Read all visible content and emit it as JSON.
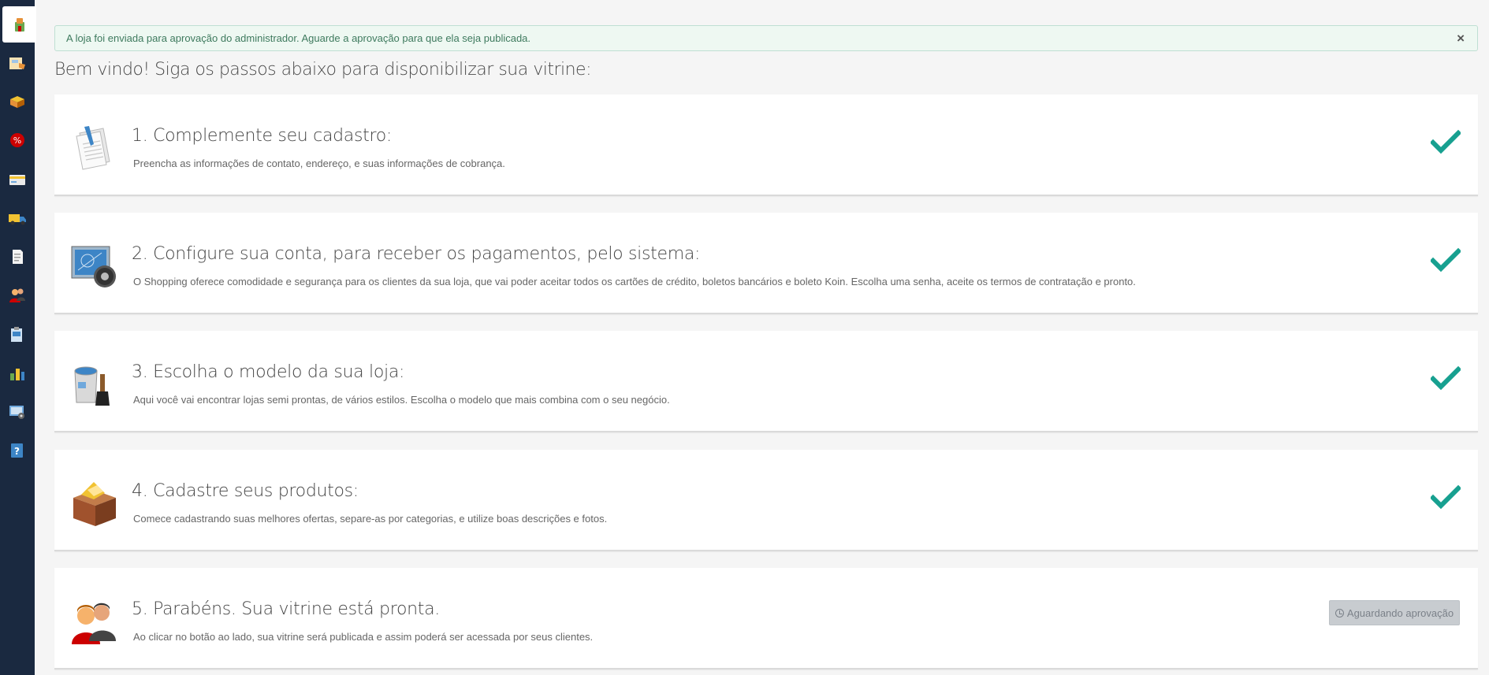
{
  "alert": {
    "message": "A loja foi enviada para aprovação do administrador. Aguarde a aprovação para que ela seja publicada.",
    "close_glyph": "×"
  },
  "welcome": "Bem vindo! Siga os passos abaixo para disponibilizar sua vitrine:",
  "sidebar": {
    "items": [
      {
        "icon": "store-icon"
      },
      {
        "icon": "catalog-icon"
      },
      {
        "icon": "box-icon"
      },
      {
        "icon": "discount-icon"
      },
      {
        "icon": "card-icon"
      },
      {
        "icon": "truck-icon"
      },
      {
        "icon": "document-icon"
      },
      {
        "icon": "users-icon"
      },
      {
        "icon": "reports-icon"
      },
      {
        "icon": "chart-icon"
      },
      {
        "icon": "settings-icon"
      },
      {
        "icon": "help-icon"
      }
    ]
  },
  "steps": [
    {
      "title": "1. Complemente seu cadastro:",
      "description": "Preencha as informações de contato, endereço, e suas informações de cobrança.",
      "icon": "document-pen-icon",
      "status": "done"
    },
    {
      "title": "2. Configure sua conta, para receber os pagamentos, pelo sistema:",
      "description": "O Shopping oferece comodidade e segurança para os clientes da sua loja, que vai poder aceitar todos os cartões de crédito, boletos bancários e boleto Koin. Escolha uma senha, aceite os termos de contratação e pronto.",
      "icon": "settings-screen-icon",
      "status": "done"
    },
    {
      "title": "3. Escolha o modelo da sua loja:",
      "description": "Aqui você vai encontrar lojas semi prontas, de vários estilos. Escolha o modelo que mais combina com o seu negócio.",
      "icon": "paint-bucket-icon",
      "status": "done"
    },
    {
      "title": "4. Cadastre seus produtos:",
      "description": "Comece cadastrando suas melhores ofertas, separe-as por categorias, e utilize boas descrições e fotos.",
      "icon": "package-icon",
      "status": "done"
    },
    {
      "title": "5. Parabéns. Sua vitrine está pronta.",
      "description": "Ao clicar no botão ao lado, sua vitrine será publicada e assim poderá ser acessada por seus clientes.",
      "icon": "people-icon",
      "status": "pending",
      "button_label": "Aguardando aprovação"
    }
  ],
  "colors": {
    "sidebar": "#1a2940",
    "check": "#17a090",
    "alert_bg": "#eef8f2",
    "alert_text": "#3e7a5e"
  }
}
